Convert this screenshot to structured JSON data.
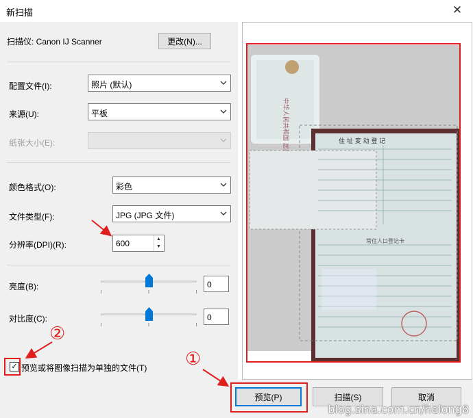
{
  "window": {
    "title": "新扫描",
    "close_glyph": "✕"
  },
  "scanner": {
    "label": "扫描仪: Canon IJ Scanner",
    "change_button": "更改(N)..."
  },
  "fields": {
    "profile": {
      "label": "配置文件(I):",
      "value": "照片 (默认)"
    },
    "source": {
      "label": "来源(U):",
      "value": "平板"
    },
    "paper_size": {
      "label": "纸张大小(E):",
      "value": ""
    },
    "color_format": {
      "label": "颜色格式(O):",
      "value": "彩色"
    },
    "file_type": {
      "label": "文件类型(F):",
      "value": "JPG (JPG 文件)"
    },
    "resolution": {
      "label": "分辨率(DPI)(R):",
      "value": "600"
    },
    "brightness": {
      "label": "亮度(B):",
      "value": "0",
      "level": 0.5
    },
    "contrast": {
      "label": "对比度(C):",
      "value": "0",
      "level": 0.5
    }
  },
  "preview_checkbox": {
    "label": "预览或将图像扫描为单独的文件(T)",
    "checked": true,
    "check_glyph": "✓"
  },
  "buttons": {
    "preview": "预览(P)",
    "scan": "扫描(S)",
    "cancel": "取消"
  },
  "annotations": {
    "one": "①",
    "two": "②",
    "color": "#e01e1e"
  },
  "document_text": {
    "id_card_vertical": "中华人民共和国 居民身份证",
    "booklet_header": "住 址 变 动 登 记",
    "household_card_title": "常住人口登记卡"
  },
  "watermark": "blog.sina.com.cn/helong8"
}
